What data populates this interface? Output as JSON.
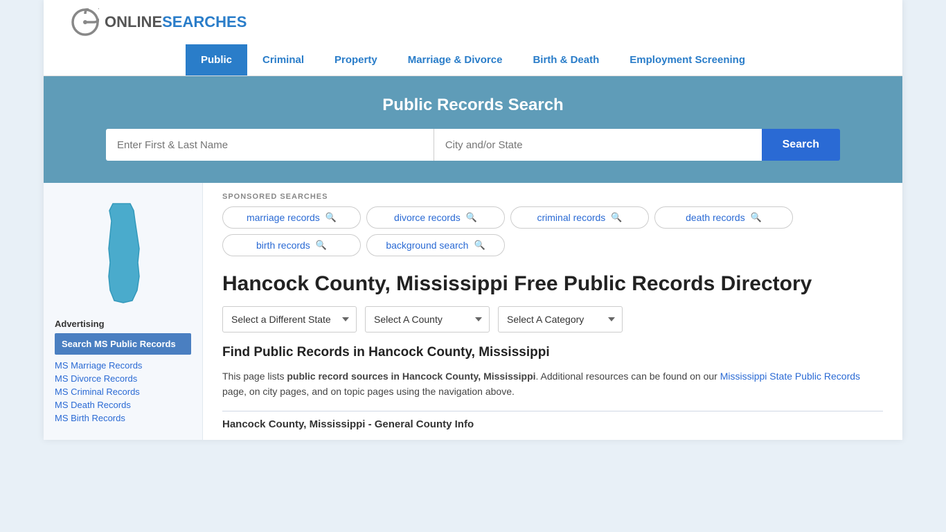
{
  "logo": {
    "text_online": "ONLINE",
    "text_searches": "SEARCHES"
  },
  "nav": {
    "items": [
      {
        "label": "Public",
        "active": true
      },
      {
        "label": "Criminal",
        "active": false
      },
      {
        "label": "Property",
        "active": false
      },
      {
        "label": "Marriage & Divorce",
        "active": false
      },
      {
        "label": "Birth & Death",
        "active": false
      },
      {
        "label": "Employment Screening",
        "active": false
      }
    ]
  },
  "hero": {
    "title": "Public Records Search",
    "name_placeholder": "Enter First & Last Name",
    "city_placeholder": "City and/or State",
    "search_label": "Search"
  },
  "sponsored": {
    "label": "SPONSORED SEARCHES",
    "pills": [
      {
        "label": "marriage records"
      },
      {
        "label": "divorce records"
      },
      {
        "label": "criminal records"
      },
      {
        "label": "death records"
      },
      {
        "label": "birth records"
      },
      {
        "label": "background search"
      }
    ]
  },
  "page_title": "Hancock County, Mississippi Free Public Records Directory",
  "dropdowns": {
    "state_label": "Select a Different State",
    "county_label": "Select A County",
    "category_label": "Select A Category"
  },
  "find_section": {
    "title": "Find Public Records in Hancock County, Mississippi",
    "description_part1": "This page lists ",
    "description_bold": "public record sources in Hancock County, Mississippi",
    "description_part2": ". Additional resources can be found on our ",
    "link_text": "Mississippi State Public Records",
    "description_part3": " page, on city pages, and on topic pages using the navigation above."
  },
  "general_info": {
    "title": "Hancock County, Mississippi - General County Info"
  },
  "sidebar": {
    "advertising_label": "Advertising",
    "featured": {
      "label": "Search MS Public Records"
    },
    "links": [
      {
        "label": "MS Marriage Records"
      },
      {
        "label": "MS Divorce Records"
      },
      {
        "label": "MS Criminal Records"
      },
      {
        "label": "MS Death Records"
      },
      {
        "label": "MS Birth Records"
      }
    ]
  }
}
